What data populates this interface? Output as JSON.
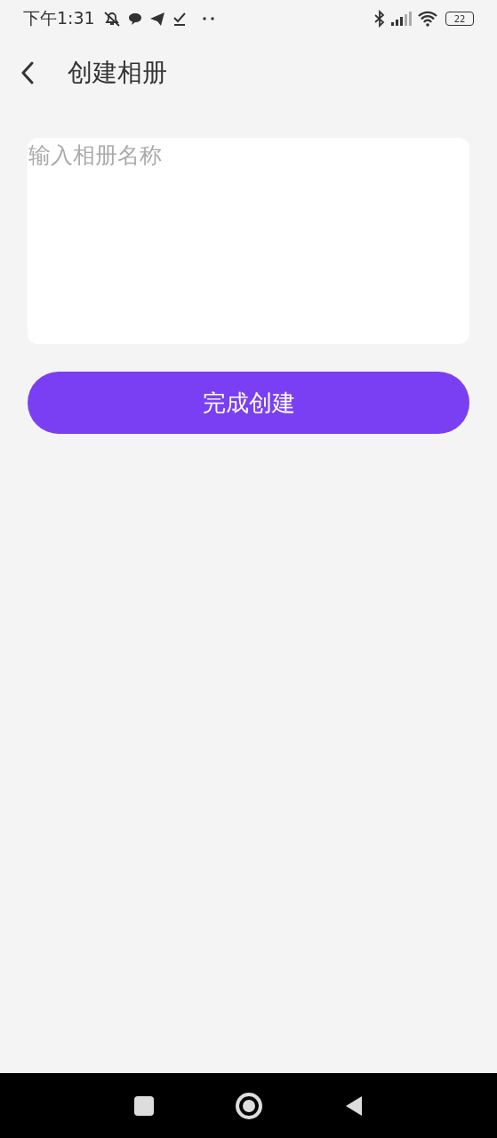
{
  "status_bar": {
    "time": "下午1:31",
    "battery": "22"
  },
  "header": {
    "title": "创建相册"
  },
  "album_name": {
    "placeholder": "输入相册名称"
  },
  "button": {
    "label": "完成创建"
  }
}
